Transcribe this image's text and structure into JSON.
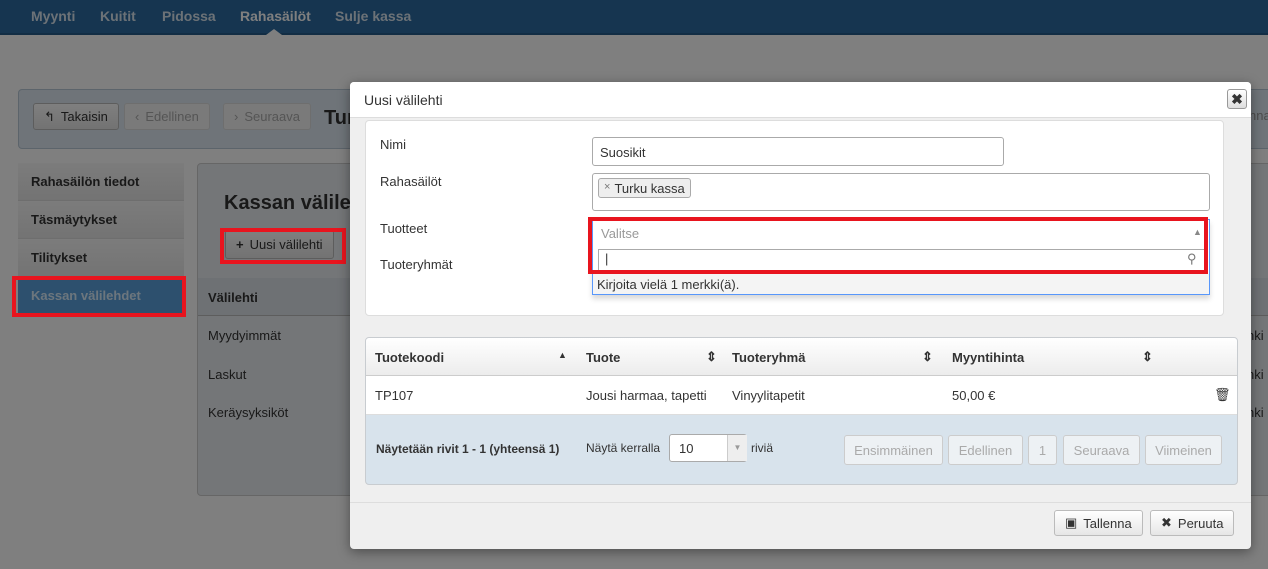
{
  "nav": {
    "items": [
      "Myynti",
      "Kuitit",
      "Pidossa",
      "Rahasäilöt",
      "Sulje kassa"
    ],
    "active": "Rahasäilöt"
  },
  "toolbar": {
    "back": "Takaisin",
    "prev": "Edellinen",
    "next": "Seuraava",
    "title_fragment": "Tur",
    "right_fragment": "nna"
  },
  "sidebar": {
    "items": [
      "Rahasäilön tiedot",
      "Täsmäytykset",
      "Tilitykset",
      "Kassan välilehdet"
    ],
    "selected": "Kassan välilehdet"
  },
  "content": {
    "title": "Kassan välilehdet",
    "new_tab_button": "Uusi välilehti",
    "column": "Välilehti",
    "rows": [
      "Myydyimmät",
      "Laskut",
      "Keräysyksiköt"
    ],
    "right_fragment": "nki"
  },
  "modal": {
    "title": "Uusi välilehti",
    "close_icon": "close-icon",
    "form": {
      "name_label": "Nimi",
      "name_value": "Suosikit",
      "cash_label": "Rahasäilöt",
      "cash_tags": [
        "Turku kassa"
      ],
      "products_label": "Tuotteet",
      "products_placeholder": "Valitse",
      "search_value": "",
      "search_hint": "Kirjoita vielä 1 merkki(ä).",
      "groups_label": "Tuoteryhmät"
    },
    "table": {
      "columns": [
        "Tuotekoodi",
        "Tuote",
        "Tuoteryhmä",
        "Myyntihinta"
      ],
      "rows": [
        {
          "code": "TP107",
          "product": "Jousi harmaa, tapetti",
          "group": "Vinyylitapetit",
          "price": "50,00 €"
        }
      ],
      "info": "Näytetään rivit 1 - 1 (yhteensä 1)",
      "show_label": "Näytä kerralla",
      "page_size": "10",
      "rows_label": "riviä",
      "pager": [
        "Ensimmäinen",
        "Edellinen",
        "1",
        "Seuraava",
        "Viimeinen"
      ]
    },
    "save": "Tallenna",
    "cancel": "Peruuta"
  },
  "colors": {
    "highlight": "#e8141e",
    "nav": "#2c6ba1",
    "selected": "#5aa1dd"
  }
}
